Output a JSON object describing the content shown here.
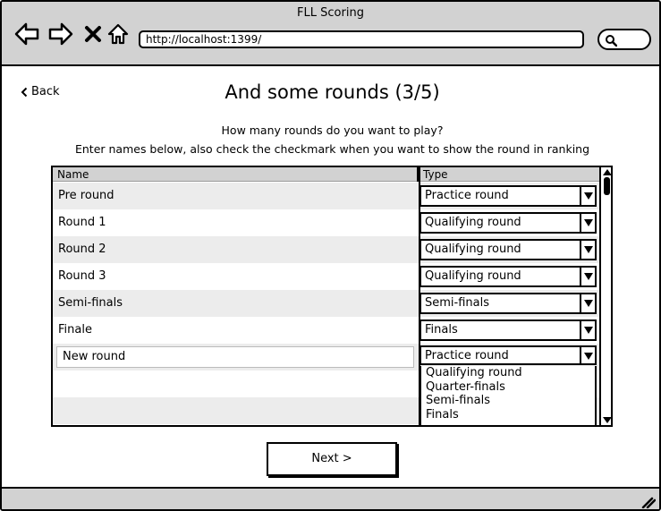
{
  "window": {
    "title": "FLL Scoring"
  },
  "browser": {
    "url": "http://localhost:1399/",
    "icons": [
      "back-arrow-icon",
      "forward-arrow-icon",
      "close-x-icon",
      "home-icon",
      "search-icon"
    ]
  },
  "page": {
    "back_label": "Back",
    "title": "And some rounds (3/5)",
    "question": "How many rounds do you want to play?",
    "instructions": "Enter names below, also check the checkmark when you want to show the round in ranking"
  },
  "table": {
    "columns": [
      "Name",
      "Type"
    ],
    "rows": [
      {
        "name": "Pre round",
        "type": "Practice round"
      },
      {
        "name": "Round 1",
        "type": "Qualifying round"
      },
      {
        "name": "Round 2",
        "type": "Qualifying round"
      },
      {
        "name": "Round 3",
        "type": "Qualifying round"
      },
      {
        "name": "Semi-finals",
        "type": "Semi-finals"
      },
      {
        "name": "Finale",
        "type": "Finals"
      }
    ],
    "new_row": {
      "name": "New round",
      "type": "Practice round"
    },
    "dropdown_options": [
      "Qualifying round",
      "Quarter-finals",
      "Semi-finals",
      "Finals"
    ]
  },
  "actions": {
    "next_label": "Next >"
  }
}
